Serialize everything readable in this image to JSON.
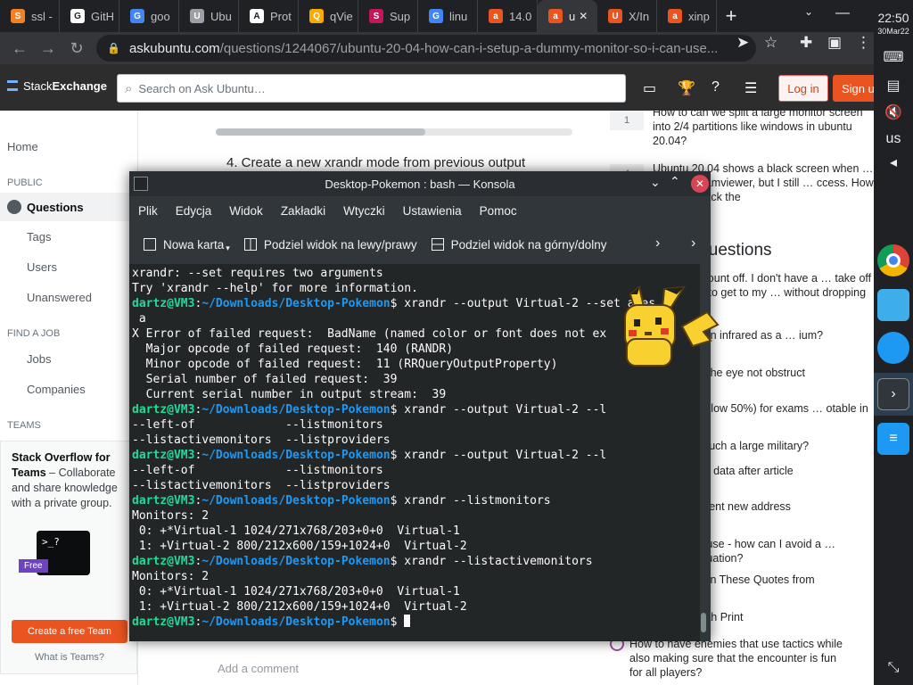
{
  "browser": {
    "tabs": [
      {
        "label": "ssl -",
        "fav_color": "#f48024",
        "fav_text": "S"
      },
      {
        "label": "GitH",
        "fav_color": "#ffffff",
        "fav_text": "G"
      },
      {
        "label": "goo",
        "fav_color": "#4285f4",
        "fav_text": "G"
      },
      {
        "label": "Ubu",
        "fav_color": "#9aa0a6",
        "fav_text": "U"
      },
      {
        "label": "Prot",
        "fav_color": "#ffffff",
        "fav_text": "A"
      },
      {
        "label": "qVie",
        "fav_color": "#f9ab00",
        "fav_text": "Q"
      },
      {
        "label": "Sup",
        "fav_color": "#c2185b",
        "fav_text": "S"
      },
      {
        "label": "linu",
        "fav_color": "#4285f4",
        "fav_text": "G"
      },
      {
        "label": "14.0",
        "fav_color": "#e95420",
        "fav_text": "a"
      },
      {
        "label": "u",
        "fav_color": "#e95420",
        "fav_text": "a"
      },
      {
        "label": "X/In",
        "fav_color": "#e95420",
        "fav_text": "U"
      },
      {
        "label": "xinp",
        "fav_color": "#e95420",
        "fav_text": "a"
      }
    ],
    "url_host": "askubuntu.com",
    "url_path": "/questions/1244067/ubuntu-20-04-how-can-i-setup-a-dummy-monitor-so-i-can-use..."
  },
  "site": {
    "logo_light": "Stack",
    "logo_bold": "Exchange",
    "search_placeholder": "Search on Ask Ubuntu…",
    "login": "Log in",
    "signup": "Sign u",
    "nav": {
      "home": "Home",
      "public": "PUBLIC",
      "questions": "Questions",
      "tags": "Tags",
      "users": "Users",
      "unanswered": "Unanswered",
      "find_a_job": "FIND A JOB",
      "jobs": "Jobs",
      "companies": "Companies",
      "teams": "TEAMS"
    },
    "teams_card": {
      "title": "Stack Overflow for Teams",
      "body": " – Collaborate and share knowledge with a private group.",
      "free": "Free",
      "cta": "Create a free Team",
      "what": "What is Teams?"
    },
    "main": {
      "step4": "4. Create a new xrandr mode from previous output",
      "behind_text": "…",
      "add_comment": "Add a comment"
    },
    "sidebar": {
      "q1_votes": "1",
      "q1": "How to can we split a large monitor screen into 2/4 partitions like windows in ubuntu 20.04?",
      "q2_votes": "4",
      "q2": "Ubuntu 20.04 shows a black screen when … through Teamviewer, but I still … ccess. How can I get back the",
      "hnq_head": "Questions",
      "hnq": [
        "… motor mount off. I don't have a … take off that mount to get to my … without dropping the motor?",
        "… aster than infrared as a … ium?",
        "… ssels in the eye not obstruct",
        "… rates (below 50%) for exams … otable in Germany?",
        "… A have such a large military?",
        "… research data after article",
        "… t implement new address",
        "… here clause - how can I avoid a … articular situation?",
        "… of \"iste\" in These Quotes from",
        "… or Do with Print",
        "How to have enemies that use tactics while also making sure that the encounter is fun for all players?"
      ]
    }
  },
  "konsole": {
    "title": "Desktop-Pokemon : bash — Konsola",
    "menus": [
      "Plik",
      "Edycja",
      "Widok",
      "Zakładki",
      "Wtyczki",
      "Ustawienia",
      "Pomoc"
    ],
    "toolbar": {
      "new_tab": "Nowa karta",
      "split_lr": "Podziel widok na lewy/prawy",
      "split_tb": "Podziel widok na górny/dolny"
    },
    "prompt_user": "dartz@VM3",
    "prompt_path": "~/Downloads/Desktop-Pokemon",
    "lines": [
      {
        "t": "out",
        "text": "xrandr: --set requires two arguments"
      },
      {
        "t": "out",
        "text": "Try 'xrandr --help' for more information."
      },
      {
        "t": "cmd",
        "text": " xrandr --output Virtual-2 --set awes"
      },
      {
        "t": "out",
        "text": " a"
      },
      {
        "t": "out",
        "text": "X Error of failed request:  BadName (named color or font does not ex"
      },
      {
        "t": "out",
        "text": "  Major opcode of failed request:  140 (RANDR)"
      },
      {
        "t": "out",
        "text": "  Minor opcode of failed request:  11 (RRQueryOutputProperty)"
      },
      {
        "t": "out",
        "text": "  Serial number of failed request:  39"
      },
      {
        "t": "out",
        "text": "  Current serial number in output stream:  39"
      },
      {
        "t": "cmd",
        "text": " xrandr --output Virtual-2 --l"
      },
      {
        "t": "out",
        "text": "--left-of             --listmonitors"
      },
      {
        "t": "out",
        "text": "--listactivemonitors  --listproviders"
      },
      {
        "t": "cmd",
        "text": " xrandr --output Virtual-2 --l"
      },
      {
        "t": "out",
        "text": "--left-of             --listmonitors"
      },
      {
        "t": "out",
        "text": "--listactivemonitors  --listproviders"
      },
      {
        "t": "cmd",
        "text": " xrandr --listmonitors"
      },
      {
        "t": "out",
        "text": "Monitors: 2"
      },
      {
        "t": "out",
        "text": " 0: +*Virtual-1 1024/271x768/203+0+0  Virtual-1"
      },
      {
        "t": "out",
        "text": " 1: +Virtual-2 800/212x600/159+1024+0  Virtual-2"
      },
      {
        "t": "cmd",
        "text": " xrandr --listactivemonitors"
      },
      {
        "t": "out",
        "text": "Monitors: 2"
      },
      {
        "t": "out",
        "text": " 0: +*Virtual-1 1024/271x768/203+0+0  Virtual-1"
      },
      {
        "t": "out",
        "text": " 1: +Virtual-2 800/212x600/159+1024+0  Virtual-2"
      },
      {
        "t": "cur",
        "text": " "
      }
    ]
  },
  "shelf": {
    "time": "22:50",
    "date": "30Mar22",
    "ime": "us"
  }
}
